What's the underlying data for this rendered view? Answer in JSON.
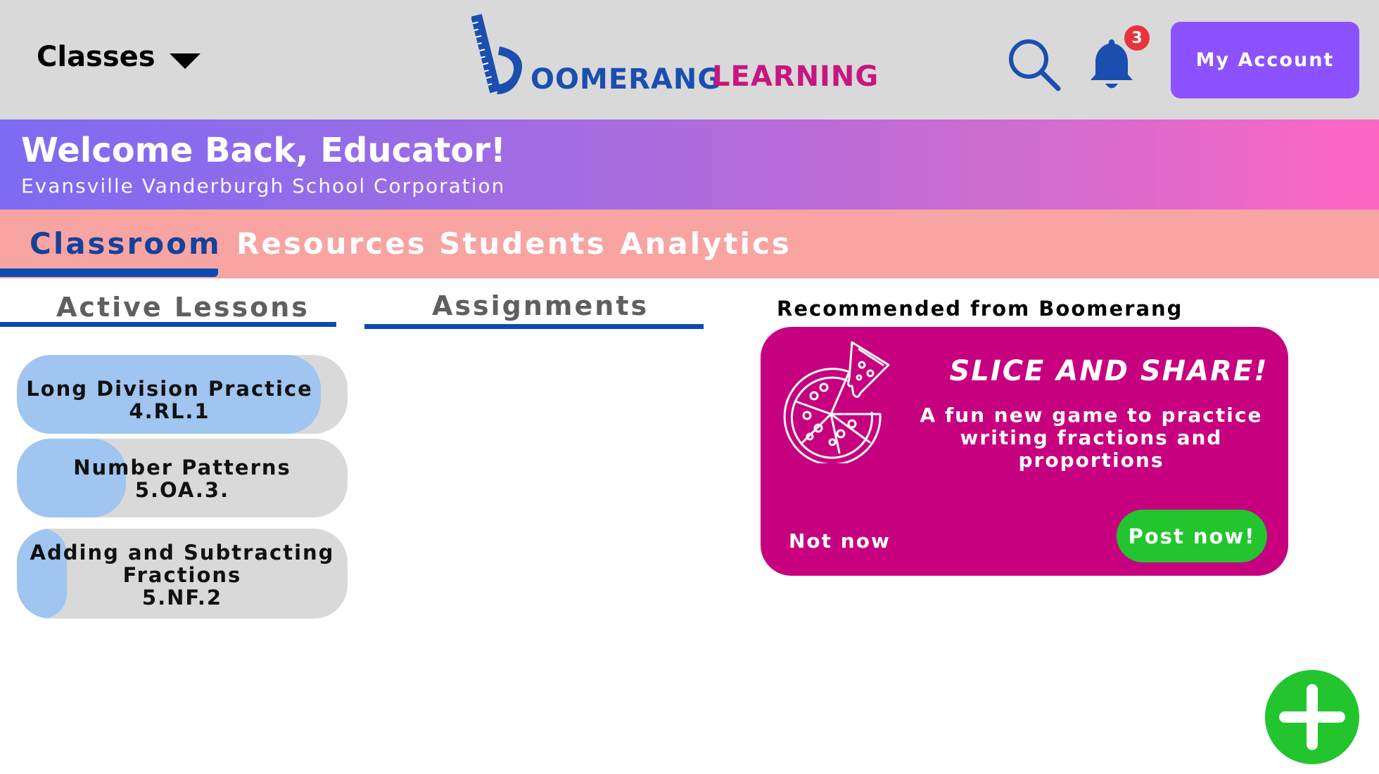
{
  "header": {
    "classes_label": "Classes",
    "logo": {
      "word1": "OOMERANG",
      "word2": "LEARNING"
    },
    "notification_count": "3",
    "account_label": "My Account"
  },
  "welcome": {
    "title": "Welcome Back, Educator!",
    "subtitle": "Evansville Vanderburgh School Corporation"
  },
  "nav": {
    "tabs": [
      {
        "label": "Classroom",
        "active": true
      },
      {
        "label": "Resources",
        "active": false
      },
      {
        "label": "Students",
        "active": false
      },
      {
        "label": "Analytics",
        "active": false
      }
    ]
  },
  "sections": {
    "active_lessons": "Active Lessons",
    "assignments": "Assignments"
  },
  "lessons": [
    {
      "title": "Long Division Practice",
      "code": "4.RL.1",
      "progress": 0.92
    },
    {
      "title": "Number Patterns",
      "code": "5.OA.3.",
      "progress": 0.33
    },
    {
      "title_line1": "Adding and Subtracting",
      "title_line2": "Fractions",
      "code": "5.NF.2",
      "progress": 0.15
    }
  ],
  "recommendation": {
    "heading": "Recommended from Boomerang",
    "card_title": "SLICE AND SHARE!",
    "card_desc_line1": "A fun new game to practice",
    "card_desc_line2": "writing fractions and",
    "card_desc_line3": "proportions",
    "dismiss_label": "Not now",
    "post_label": "Post now!"
  },
  "colors": {
    "accent": "#8c52ff",
    "brand_blue": "#1a4fb0",
    "brand_magenta": "#c6007e",
    "success": "#22c52d"
  },
  "icons": [
    "chevron-down-icon",
    "boomerang-logo",
    "search-icon",
    "bell-icon",
    "pizza-icon",
    "plus-icon"
  ]
}
